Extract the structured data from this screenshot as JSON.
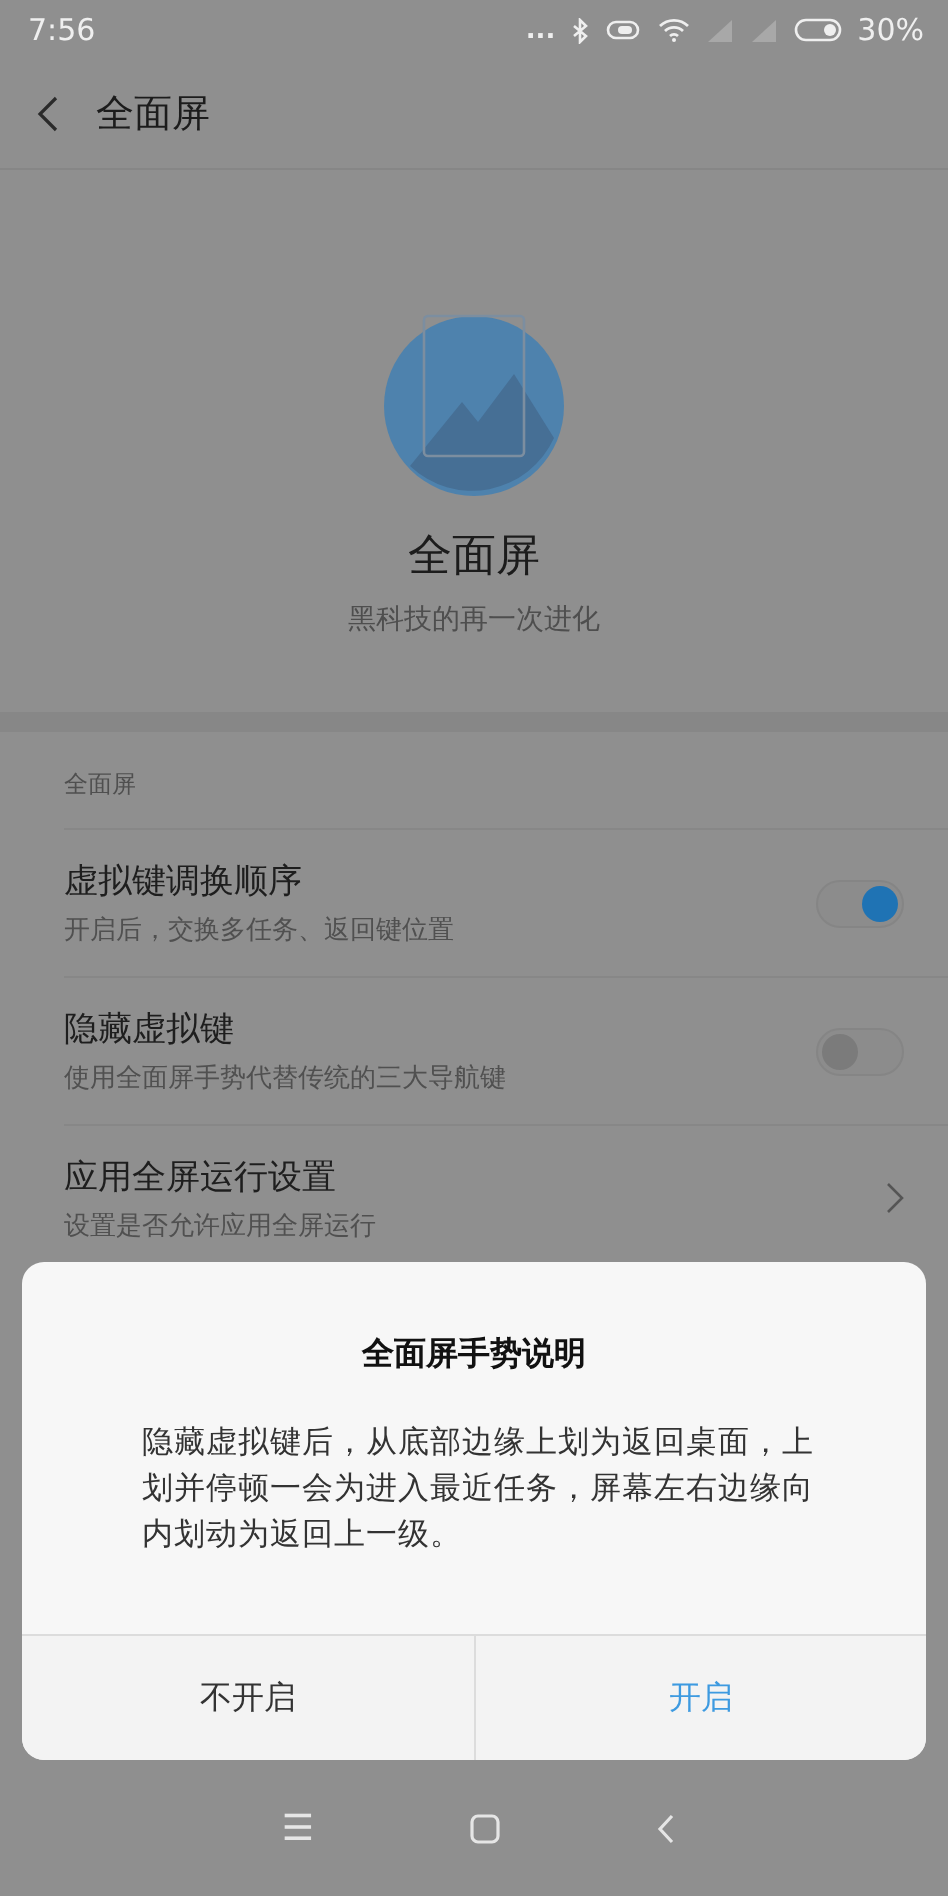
{
  "status_bar": {
    "time": "7:56",
    "more": "...",
    "battery": "30%"
  },
  "header": {
    "title": "全面屏"
  },
  "hero": {
    "title": "全面屏",
    "subtitle": "黑科技的再一次进化"
  },
  "section": {
    "title": "全面屏"
  },
  "settings": [
    {
      "kind": "toggle",
      "title": "虚拟键调换顺序",
      "subtitle": "开启后，交换多任务、返回键位置",
      "on": true
    },
    {
      "kind": "toggle",
      "title": "隐藏虚拟键",
      "subtitle": "使用全面屏手势代替传统的三大导航键",
      "on": false
    },
    {
      "kind": "link",
      "title": "应用全屏运行设置",
      "subtitle": "设置是否允许应用全屏运行"
    }
  ],
  "dialog": {
    "title": "全面屏手势说明",
    "message": "隐藏虚拟键后，从底部边缘上划为返回桌面，上划并停顿一会为进入最近任务，屏幕左右边缘向内划动为返回上一级。",
    "buttons": [
      {
        "label": "不开启",
        "kind": "cancel"
      },
      {
        "label": "开启",
        "kind": "confirm"
      }
    ]
  },
  "nav_bar": {
    "menu": "☰"
  }
}
